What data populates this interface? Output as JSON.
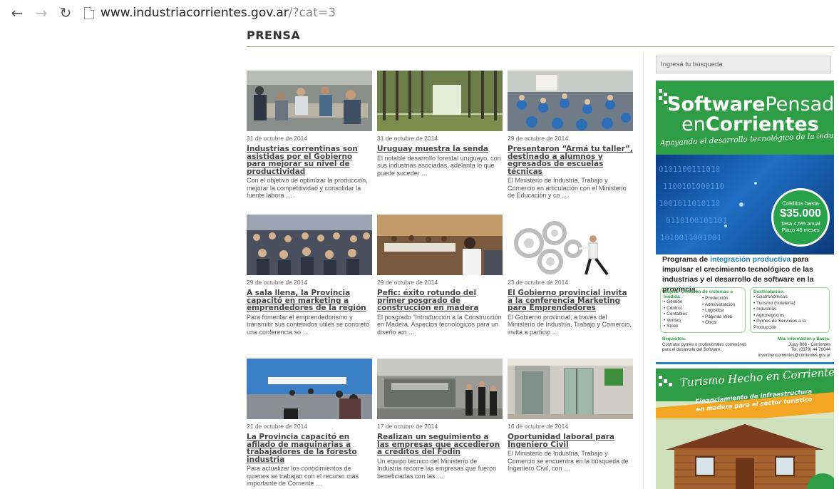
{
  "browser": {
    "url_host": "www.industriacorrientes.gov.ar",
    "url_path": "/?cat=3"
  },
  "page": {
    "title": "PRENSA"
  },
  "articles": [
    {
      "date": "31 de octubre de 2014",
      "title": "Industrias correntinas son asistidas por el Gobierno para mejorar su nivel de productividad",
      "excerpt": "Con el objetivo de optimizar la producción, mejorar la competitividad y consolidar la fuente labora …"
    },
    {
      "date": "31 de octubre de 2014",
      "title": "Uruguay muestra la senda",
      "excerpt": "El notable desarrollo forestal uruguayo, con sus industrias asociadas, adelanta lo que puede suceder …"
    },
    {
      "date": "29 de octubre de 2014",
      "title": "Presentaron “Armá tu taller”, destinado a alumnos y egresados de escuelas técnicas",
      "excerpt": "El Ministerio de Industria, Trabajo y Comercio en articulación con el Ministerio de Educación y co …"
    },
    {
      "date": "29 de octubre de 2014",
      "title": "A sala llena, la Provincia capacitó en marketing a emprendedores de la región",
      "excerpt": "Para fomentar el emprendedorismo y transmitir sus contenidos útiles se concretó una conferencia so …"
    },
    {
      "date": "29 de octubre de 2014",
      "title": "Pefic: éxito rotundo del primer posgrado de construcción en madera",
      "excerpt": "El posgrado “Introducción a la Construcción en Madera. Aspectos tecnológicos para un diseño am …"
    },
    {
      "date": "23 de octubre de 2014",
      "title": "El Gobierno provincial invita a la conferencia Marketing para Emprendedores",
      "excerpt": "El Gobierno provincial, a través del Ministerio de Industria, Trabajo y Comercio, invita a particip …"
    },
    {
      "date": "21 de octubre de 2014",
      "title": "La Provincia capacitó en afilado de maquinarias a trabajadores de la foresto industria",
      "excerpt": "Para actualizar los conocimientos de quienes se trabajan con el recurso más importante de Corriente …"
    },
    {
      "date": "17 de octubre de 2014",
      "title": "Realizan un seguimiento a las empresas que accedieron a créditos del Fodin",
      "excerpt": "Un equipo técnico del Ministerio de Industria recorre las empresas que fueron beneficiadas con las …"
    },
    {
      "date": "16 de octubre de 2014",
      "title": "Oportunidad laboral para Ingeniero Civil",
      "excerpt": "El Ministerio de Industria, Trabajo y Comercio se encuentra en la búsqueda de Ingeniero Civil, con …"
    }
  ],
  "sidebar": {
    "search_placeholder": "Ingresá tu búsqueda",
    "banner1": {
      "brand_software": "Software",
      "brand_pensado": "Pensado",
      "brand_en": "en",
      "brand_corrientes": "Corrientes",
      "tagline": "Apoyando el desarrollo tecnológico de la industria",
      "credit_label": "Créditos hasta",
      "credit_amount": "$35.000",
      "credit_rate": "Tasa 4,5% anual",
      "credit_term": "Plazo 48 meses",
      "program_pre": "Programa de ",
      "program_highlight": "integración productiva",
      "program_post": " para impulsar el crecimiento tecnológico de las industrias y el desarrollo de software en la provincia.",
      "objective_title": "Objeto: Creación de sistemas a medida",
      "objective_col1": [
        "• Gestión",
        "• Control",
        "• Contables",
        "• Ventas",
        "• Stock"
      ],
      "objective_col2": [
        "• Producción",
        "• Administración",
        "• Logística",
        "• Páginas Web",
        "• Otros"
      ],
      "recipients_title": "Destinatarios:",
      "recipients": [
        "• Gastronómicos",
        "• Turismo (hotelería)",
        "• Industrias",
        "• Agronegocios",
        "• Pymes de Servicios a la Producción"
      ],
      "requirements_title": "Requisitos:",
      "requirements_text": "Contratar pymes o profesionales correntinos para el desarrollo del Software.",
      "info_title": "Más información y Bases:",
      "info_address": "Jujuy 886 - Corrientes",
      "info_phone": "Tel: (0379) 44 76044",
      "info_email": "invertirencorrientes@corrientes.gov.ar"
    },
    "banner2": {
      "title": "Turismo Hecho en Corrientes",
      "subtitle_line1": "Financiamiento de infraestructura",
      "subtitle_line2": "en madera para el sector turístico"
    }
  },
  "colors": {
    "accent_green": "#2e9d46",
    "accent_blue": "#1f84c4",
    "title_rule": "#9aa26a"
  }
}
